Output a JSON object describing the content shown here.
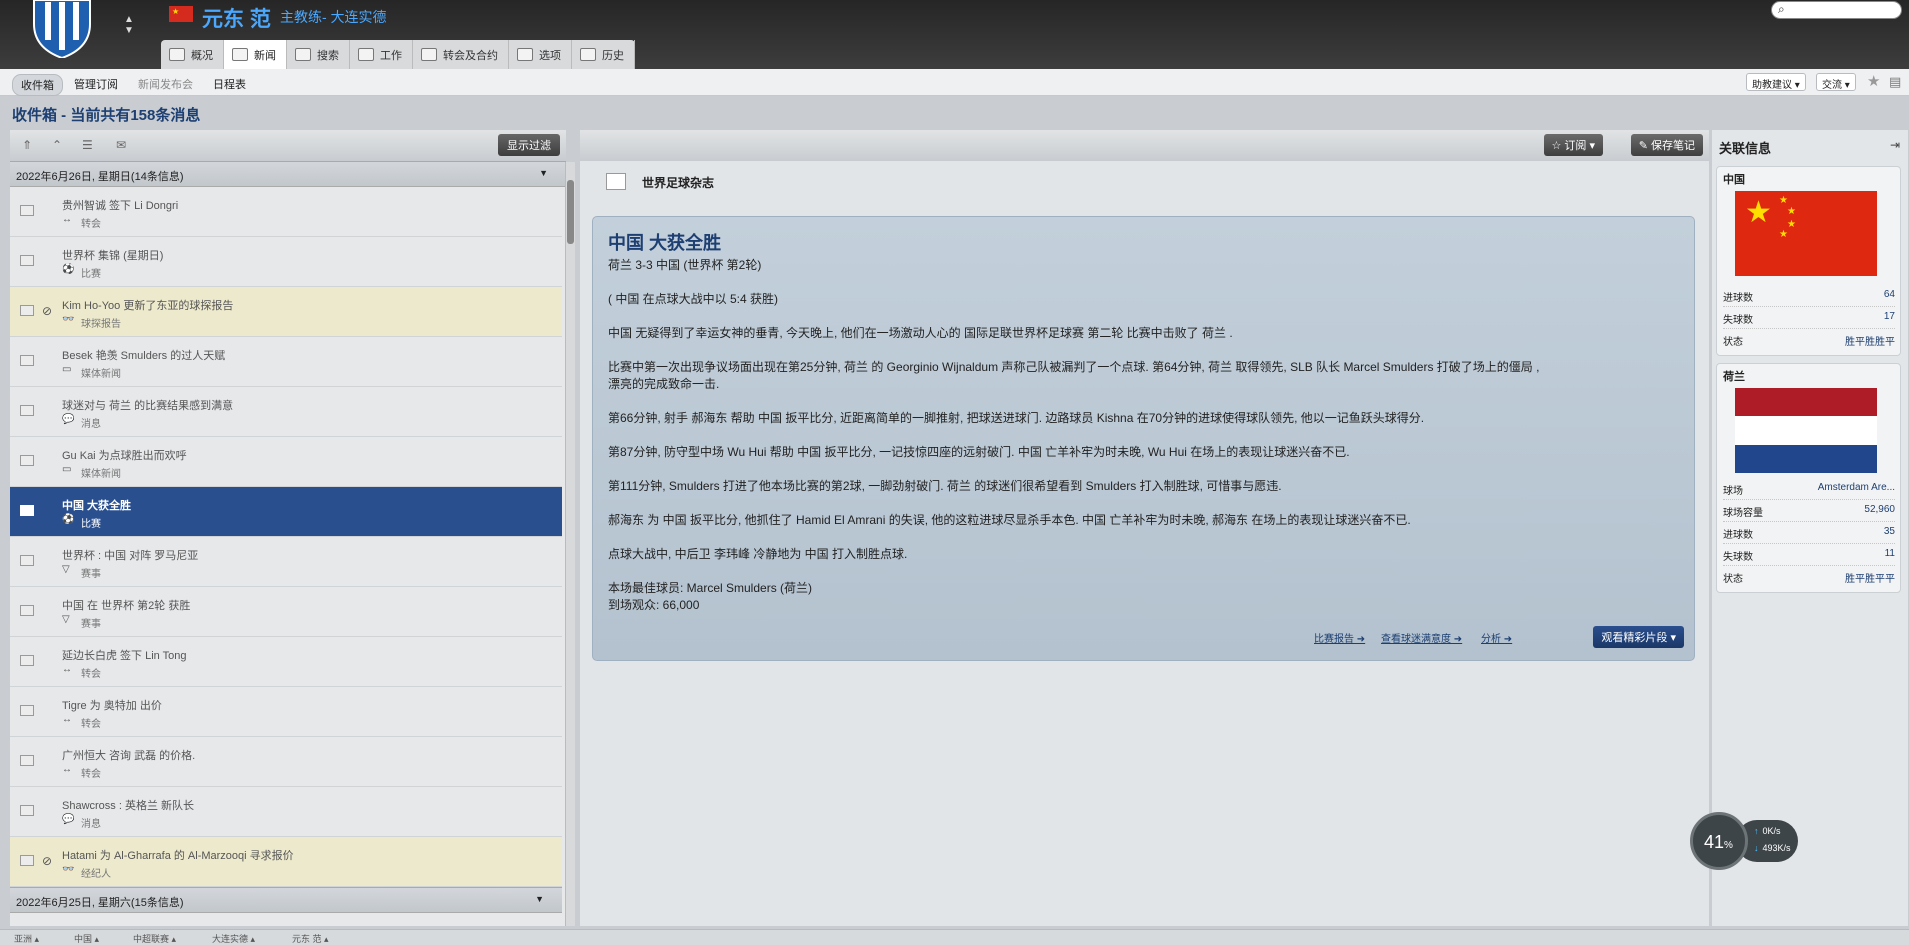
{
  "header": {
    "manager_name": "元东 范",
    "manager_role": "主教练- 大连实德",
    "tabs": [
      {
        "label": "概况"
      },
      {
        "label": "新闻"
      },
      {
        "label": "搜索"
      },
      {
        "label": "工作"
      },
      {
        "label": "转会及合约"
      },
      {
        "label": "选项"
      },
      {
        "label": "历史"
      }
    ]
  },
  "subnav": {
    "items": [
      "收件箱",
      "管理订阅",
      "新闻发布会",
      "日程表"
    ],
    "drop_assistant": "助教建议",
    "drop_social": "交流"
  },
  "page_title": "收件箱 - 当前共有158条消息",
  "left_panel": {
    "filter_label": "显示过滤",
    "date_header": "2022年6月26日, 星期日(14条信息)",
    "bottom_date_header": "2022年6月25日, 星期六(15条信息)",
    "messages": [
      {
        "title": "贵州智诚 签下 Li Dongri",
        "category": "转会",
        "icon": "↔"
      },
      {
        "title": "世界杯 集锦 (星期日)",
        "category": "比赛",
        "icon": "⚽"
      },
      {
        "title": "Kim Ho-Yoo 更新了东亚的球探报告",
        "category": "球探报告",
        "icon": "👓"
      },
      {
        "title": "Besek 艳羡 Smulders 的过人天赋",
        "category": "媒体新闻",
        "icon": "▭"
      },
      {
        "title": "球迷对与 荷兰 的比赛结果感到满意",
        "category": "消息",
        "icon": "💬"
      },
      {
        "title": "Gu Kai 为点球胜出而欢呼",
        "category": "媒体新闻",
        "icon": "▭"
      },
      {
        "title": "中国 大获全胜",
        "category": "比赛",
        "icon": "⚽"
      },
      {
        "title": "世界杯 : 中国 对阵 罗马尼亚",
        "category": "赛事",
        "icon": "▽"
      },
      {
        "title": "中国 在 世界杯 第2轮 获胜",
        "category": "赛事",
        "icon": "▽"
      },
      {
        "title": "延边长白虎 签下 Lin Tong",
        "category": "转会",
        "icon": "↔"
      },
      {
        "title": "Tigre 为 奥特加 出价",
        "category": "转会",
        "icon": "↔"
      },
      {
        "title": "广州恒大 咨询 武磊 的价格.",
        "category": "转会",
        "icon": "↔"
      },
      {
        "title": "Shawcross : 英格兰 新队长",
        "category": "消息",
        "icon": "💬"
      },
      {
        "title": "Hatami 为 Al-Gharrafa 的 Al-Marzooqi 寻求报价",
        "category": "经纪人",
        "icon": "👓"
      }
    ]
  },
  "article": {
    "source": "世界足球杂志",
    "subscribe_label": "订阅",
    "save_label": "保存笔记",
    "headline": "中国 大获全胜",
    "score_line": "荷兰 3-3 中国 (世界杯 第2轮)",
    "penalty_line": "( 中国 在点球大战中以 5:4 获胜)",
    "p1": "中国 无疑得到了幸运女神的垂青, 今天晚上, 他们在一场激动人心的 国际足联世界杯足球赛 第二轮 比赛中击败了 荷兰 .",
    "p2a": "比赛中第一次出现争议场面出现在第25分钟, 荷兰 的 Georginio Wijnaldum 声称己队被漏判了一个点球. 第64分钟, 荷兰 取得领先, SLB 队长 Marcel Smulders 打破了场上的僵局 ,",
    "p2b": "漂亮的完成致命一击.",
    "p3": "第66分钟, 射手 郝海东 帮助 中国 扳平比分, 近距离简单的一脚推射, 把球送进球门. 边路球员 Kishna 在70分钟的进球使得球队领先, 他以一记鱼跃头球得分.",
    "p4": "第87分钟, 防守型中场 Wu Hui 帮助 中国 扳平比分, 一记技惊四座的远射破门. 中国 亡羊补牢为时未晚, Wu Hui 在场上的表现让球迷兴奋不已.",
    "p5": "第111分钟, Smulders 打进了他本场比赛的第2球, 一脚劲射破门. 荷兰 的球迷们很希望看到 Smulders 打入制胜球, 可惜事与愿违.",
    "p6": "郝海东 为 中国 扳平比分, 他抓住了 Hamid El Amrani 的失误, 他的这粒进球尽显杀手本色. 中国 亡羊补牢为时未晚, 郝海东 在场上的表现让球迷兴奋不已.",
    "p7": "点球大战中, 中后卫 李玮峰 冷静地为 中国 打入制胜点球.",
    "mvp": "本场最佳球员: Marcel Smulders (荷兰)",
    "attendance": "到场观众: 66,000",
    "link_report": "比赛报告",
    "link_fans": "查看球迷满意度",
    "link_analysis": "分析",
    "highlights_label": "观看精彩片段"
  },
  "right_panel": {
    "title": "关联信息",
    "china": {
      "name": "中国",
      "stats": [
        {
          "label": "进球数",
          "value": "64"
        },
        {
          "label": "失球数",
          "value": "17"
        },
        {
          "label": "状态",
          "value": "胜平胜胜平"
        }
      ]
    },
    "netherlands": {
      "name": "荷兰",
      "stats": [
        {
          "label": "球场",
          "value": "Amsterdam Are..."
        },
        {
          "label": "球场容量",
          "value": "52,960"
        },
        {
          "label": "进球数",
          "value": "35"
        },
        {
          "label": "失球数",
          "value": "11"
        },
        {
          "label": "状态",
          "value": "胜平胜平平"
        }
      ]
    }
  },
  "bottom_crumbs": [
    "亚洲",
    "中国",
    "中超联赛",
    "大连实德",
    "元东 范"
  ],
  "net_widget": {
    "percent": "41",
    "percent_unit": "%",
    "upload": "0",
    "download": "493",
    "unit": "K/s"
  },
  "colors": {
    "accent": "#2a4f8f",
    "brand_blue": "#4aa8ff",
    "article_bg": "#b9c6d2"
  }
}
